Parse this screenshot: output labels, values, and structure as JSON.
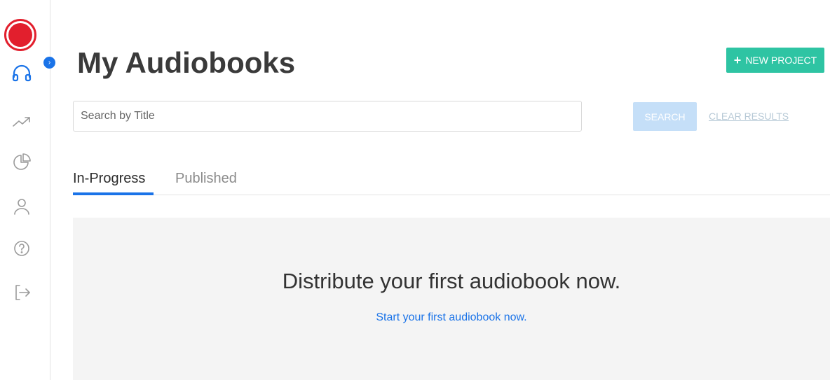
{
  "sidebar": {
    "logo": "record-logo",
    "items": [
      {
        "icon": "headphones-icon",
        "active": true
      },
      {
        "icon": "trending-up-icon",
        "active": false
      },
      {
        "icon": "pie-chart-icon",
        "active": false
      },
      {
        "icon": "user-icon",
        "active": false
      },
      {
        "icon": "help-circle-icon",
        "active": false
      },
      {
        "icon": "logout-icon",
        "active": false
      }
    ],
    "expand_glyph": "›"
  },
  "header": {
    "title": "My Audiobooks",
    "new_project_plus": "+",
    "new_project_label": "NEW PROJECT"
  },
  "search": {
    "placeholder": "Search by Title",
    "value": "",
    "button_label": "SEARCH",
    "clear_label": "CLEAR RESULTS"
  },
  "tabs": [
    {
      "label": "In-Progress",
      "active": true
    },
    {
      "label": "Published",
      "active": false
    }
  ],
  "empty_state": {
    "heading": "Distribute your first audiobook now.",
    "link": "Start your first audiobook now."
  },
  "colors": {
    "accent_blue": "#1a73e8",
    "brand_red": "#e21f2d",
    "new_project_green": "#2ec4a3",
    "search_button_disabled": "#c5dff8"
  }
}
